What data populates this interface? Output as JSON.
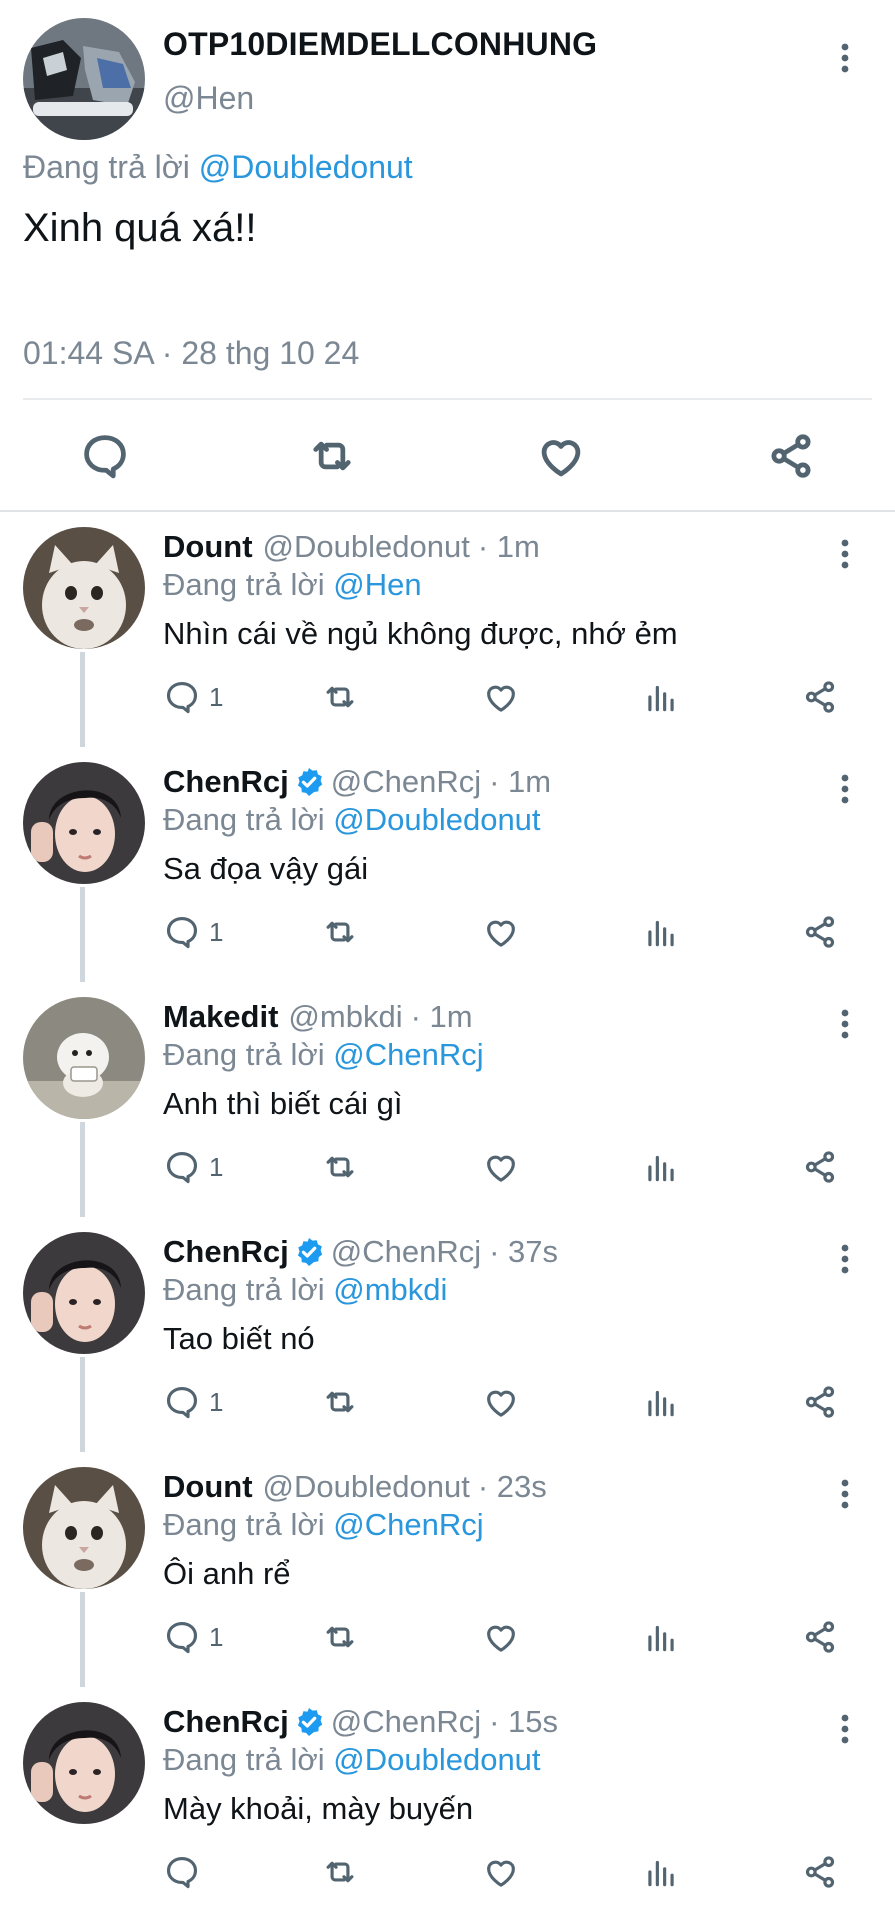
{
  "main_tweet": {
    "display_name": "OTP10DIEMDELLCONHUNG",
    "handle": "@Hen",
    "replying_prefix": "Đang trả lời",
    "replying_to": "@Doubledonut",
    "text": "Xinh quá xá!!",
    "timestamp": "01:44 SA · 28 thg 10 24",
    "actions": [
      "reply-icon",
      "retweet-icon",
      "like-icon",
      "share-icon"
    ]
  },
  "replies": [
    {
      "display_name": "Dount",
      "verified": false,
      "handle": "@Doubledonut",
      "time": "· 1m",
      "replying_prefix": "Đang trả lời",
      "replying_to": "@Hen",
      "text": "Nhìn cái về ngủ không được, nhớ ẻm",
      "reply_count": "1",
      "avatar": "white-cat"
    },
    {
      "display_name": "ChenRcj",
      "verified": true,
      "handle": "@ChenRcj",
      "time": "· 1m",
      "replying_prefix": "Đang trả lời",
      "replying_to": "@Doubledonut",
      "text": "Sa đọa vậy gái",
      "reply_count": "1",
      "avatar": "person-portrait"
    },
    {
      "display_name": "Makedit",
      "verified": false,
      "handle": "@mbkdi",
      "time": "· 1m",
      "replying_prefix": "Đang trả lời",
      "replying_to": "@ChenRcj",
      "text": "Anh thì biết cái gì",
      "reply_count": "1",
      "avatar": "white-puppy"
    },
    {
      "display_name": "ChenRcj",
      "verified": true,
      "handle": "@ChenRcj",
      "time": "· 37s",
      "replying_prefix": "Đang trả lời",
      "replying_to": "@mbkdi",
      "text": "Tao biết nó",
      "reply_count": "1",
      "avatar": "person-portrait"
    },
    {
      "display_name": "Dount",
      "verified": false,
      "handle": "@Doubledonut",
      "time": "· 23s",
      "replying_prefix": "Đang trả lời",
      "replying_to": "@ChenRcj",
      "text": "Ôi anh rể",
      "reply_count": "1",
      "avatar": "white-cat"
    },
    {
      "display_name": "ChenRcj",
      "verified": true,
      "handle": "@ChenRcj",
      "time": "· 15s",
      "replying_prefix": "Đang trả lời",
      "replying_to": "@Doubledonut",
      "text": "Mày khoải, mày buyến",
      "reply_count": "",
      "avatar": "person-portrait"
    }
  ],
  "colors": {
    "mention": "#2a97dc",
    "muted": "#7b8793",
    "verified": "#1d9bf0"
  }
}
